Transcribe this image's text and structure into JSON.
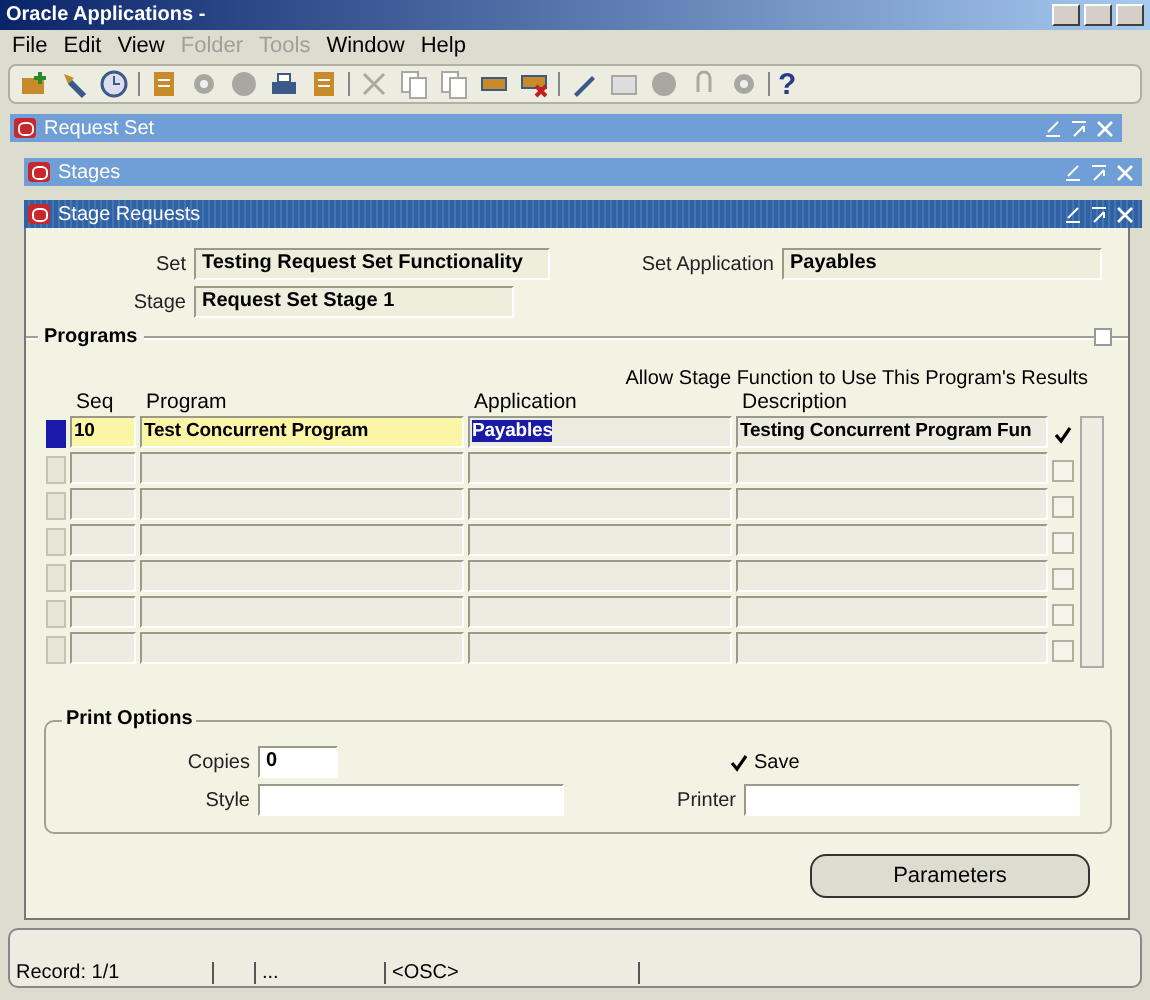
{
  "window": {
    "title": "Oracle Applications -"
  },
  "menu": [
    {
      "label": "File",
      "disabled": false
    },
    {
      "label": "Edit",
      "disabled": false
    },
    {
      "label": "View",
      "disabled": false
    },
    {
      "label": "Folder",
      "disabled": true
    },
    {
      "label": "Tools",
      "disabled": true
    },
    {
      "label": "Window",
      "disabled": false
    },
    {
      "label": "Help",
      "disabled": false
    }
  ],
  "toolbar": [
    {
      "kind": "new",
      "disabled": false
    },
    {
      "kind": "find",
      "disabled": false
    },
    {
      "kind": "clock",
      "disabled": false
    },
    {
      "kind": "sep"
    },
    {
      "kind": "note",
      "disabled": false
    },
    {
      "kind": "gear",
      "disabled": true
    },
    {
      "kind": "disc",
      "disabled": true
    },
    {
      "kind": "printer",
      "disabled": false
    },
    {
      "kind": "note",
      "disabled": false
    },
    {
      "kind": "sep"
    },
    {
      "kind": "scissors",
      "disabled": true
    },
    {
      "kind": "copy",
      "disabled": true
    },
    {
      "kind": "copy",
      "disabled": true
    },
    {
      "kind": "row",
      "disabled": false
    },
    {
      "kind": "rowdel",
      "disabled": false
    },
    {
      "kind": "sep"
    },
    {
      "kind": "pen",
      "disabled": false
    },
    {
      "kind": "box",
      "disabled": true
    },
    {
      "kind": "disc",
      "disabled": true
    },
    {
      "kind": "clip",
      "disabled": true
    },
    {
      "kind": "gear",
      "disabled": true
    },
    {
      "kind": "sep"
    },
    {
      "kind": "help",
      "label": "?"
    }
  ],
  "windows": [
    {
      "title": "Request Set",
      "active": false
    },
    {
      "title": "Stages",
      "active": false
    },
    {
      "title": "Stage Requests",
      "active": true
    }
  ],
  "header": {
    "set_label": "Set",
    "set_value": "Testing Request Set Functionality",
    "stage_label": "Stage",
    "stage_value": "Request Set Stage 1",
    "app_label": "Set Application",
    "app_value": "Payables"
  },
  "programs": {
    "title": "Programs",
    "allow_header": "Allow Stage Function to Use This Program's Results",
    "columns": [
      "Seq",
      "Program",
      "Application",
      "Description"
    ],
    "rows": [
      {
        "selected": true,
        "seq": "10",
        "program": "Test Concurrent Program",
        "application": "Payables",
        "application_highlighted": true,
        "description": "Testing Concurrent Program Fun",
        "allow": true
      },
      {
        "selected": false,
        "allow": false
      },
      {
        "selected": false,
        "allow": false
      },
      {
        "selected": false,
        "allow": false
      },
      {
        "selected": false,
        "allow": false
      },
      {
        "selected": false,
        "allow": false
      },
      {
        "selected": false,
        "allow": false
      }
    ]
  },
  "print_options": {
    "title": "Print Options",
    "copies_label": "Copies",
    "copies_value": "0",
    "save_label": "Save",
    "save_checked": true,
    "style_label": "Style",
    "printer_label": "Printer"
  },
  "buttons": [
    {
      "label": "Parameters"
    }
  ],
  "status_bar": [
    "Record: 1/1",
    "...",
    "<OSC>"
  ]
}
